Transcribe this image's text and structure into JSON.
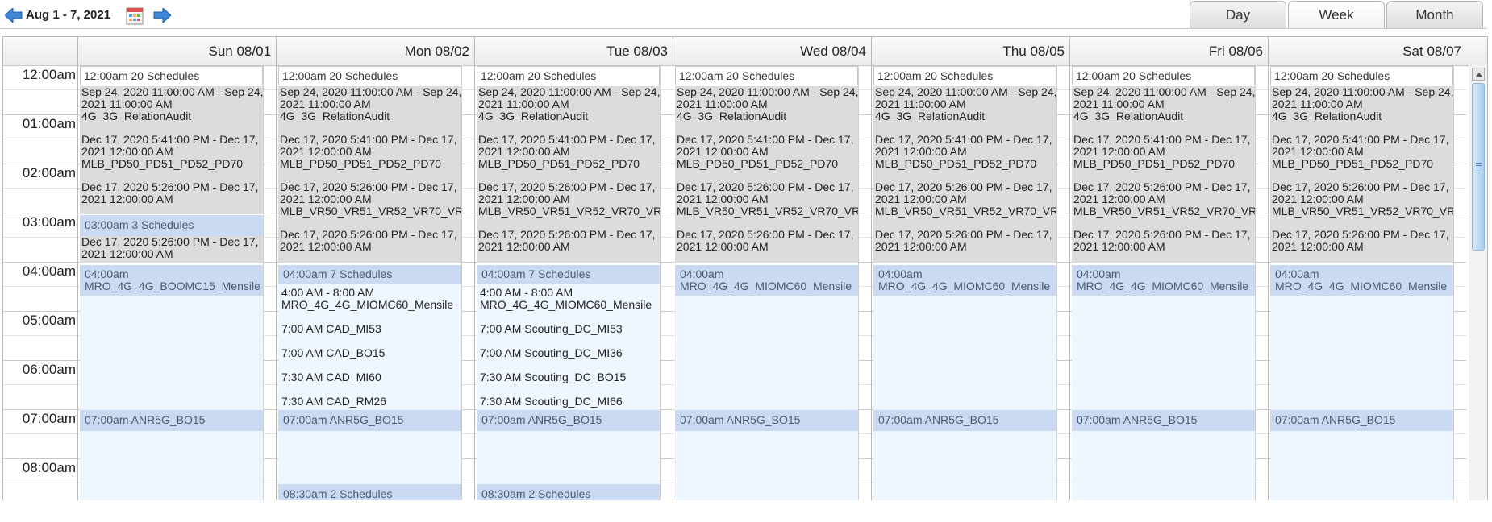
{
  "header": {
    "range_label": "Aug 1 - 7, 2021",
    "prev_icon": "arrow-left-icon",
    "next_icon": "arrow-right-icon",
    "calendar_icon": "calendar-picker-icon",
    "tabs": [
      {
        "label": "Day",
        "active": false
      },
      {
        "label": "Week",
        "active": true
      },
      {
        "label": "Month",
        "active": false
      }
    ]
  },
  "days": [
    "Sun 08/01",
    "Mon 08/02",
    "Tue 08/03",
    "Wed 08/04",
    "Thu 08/05",
    "Fri 08/06",
    "Sat 08/07"
  ],
  "times": [
    "12:00am",
    "01:00am",
    "02:00am",
    "03:00am",
    "04:00am",
    "05:00am",
    "06:00am",
    "07:00am",
    "08:00am"
  ],
  "summary_label": "12:00am 20 Schedules",
  "gray_entries": [
    "Sep 24, 2020 11:00:00 AM - Sep 24,",
    "2021 11:00:00 AM",
    "4G_3G_RelationAudit",
    "",
    "Dec 17, 2020 5:41:00 PM - Dec 17,",
    "2021 12:00:00 AM",
    "MLB_PD50_PD51_PD52_PD70",
    "",
    "Dec 17, 2020 5:26:00 PM - Dec 17,",
    "2021 12:00:00 AM",
    "MLB_VR50_VR51_VR52_VR70_VR",
    "",
    "Dec 17, 2020 5:26:00 PM - Dec 17,",
    "2021 12:00:00 AM"
  ],
  "sun_gray_entries": [
    "Sep 24, 2020 11:00:00 AM - Sep 24,",
    "2021 11:00:00 AM",
    "4G_3G_RelationAudit",
    "",
    "Dec 17, 2020 5:41:00 PM - Dec 17,",
    "2021 12:00:00 AM",
    "MLB_PD50_PD51_PD52_PD70",
    "",
    "Dec 17, 2020 5:26:00 PM - Dec 17,",
    "2021 12:00:00 AM"
  ],
  "sun_lower_entries": [
    "Dec 17, 2020 5:26:00 PM - Dec 17,",
    "2021 12:00:00 AM"
  ],
  "sun_3am": "03:00am 3 Schedules",
  "sun_4am": [
    "04:00am",
    "MRO_4G_4G_BOOMC15_Mensile"
  ],
  "mon_4am_tag": "04:00am 7 Schedules",
  "mon_entries": [
    "4:00 AM - 8:00 AM",
    "MRO_4G_4G_MIOMC60_Mensile",
    "",
    "7:00 AM CAD_MI53",
    "",
    "7:00 AM CAD_BO15",
    "",
    "7:30 AM CAD_MI60",
    "",
    "7:30 AM CAD_RM26"
  ],
  "tue_4am_tag": "04:00am 7 Schedules",
  "tue_entries": [
    "4:00 AM - 8:00 AM",
    "MRO_4G_4G_MIOMC60_Mensile",
    "",
    "7:00 AM Scouting_DC_MI53",
    "",
    "7:00 AM Scouting_DC_MI36",
    "",
    "7:30 AM Scouting_DC_BO15",
    "",
    "7:30 AM Scouting_DC_MI66"
  ],
  "other_4am": [
    "04:00am",
    "MRO_4G_4G_MIOMC60_Mensile"
  ],
  "seven_am": "07:00am ANR5G_BO15",
  "eight_thirty": "08:30am 2 Schedules",
  "colors": {
    "gray_block": "#dcdcdc",
    "blue_tag": "#c9daf2",
    "blue_block": "#eef6ff"
  }
}
